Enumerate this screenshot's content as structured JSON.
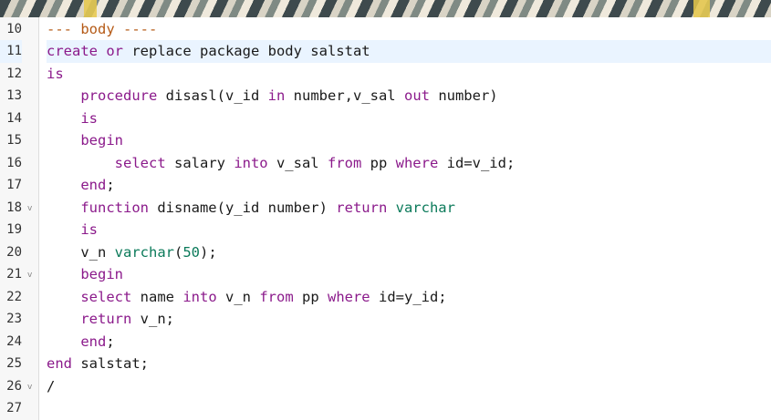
{
  "banner": {
    "colors": [
      "#3e4a4d",
      "#d9d4c6",
      "#e6c84a"
    ]
  },
  "colors": {
    "keyword": "#8b1a8b",
    "type": "#0b7a5a",
    "comment": "#b55a16",
    "plain": "#1a1a1a",
    "gutter_bg": "#f7f7f7",
    "active_line": "#eaf4ff"
  },
  "editor": {
    "active_line": "11",
    "lines": [
      {
        "num": "10",
        "fold": "",
        "segments": [
          {
            "t": "--- body ----",
            "c": "cm"
          }
        ]
      },
      {
        "num": "11",
        "fold": "",
        "segments": [
          {
            "t": "create ",
            "c": "kw"
          },
          {
            "t": "or ",
            "c": "kw"
          },
          {
            "t": "replace package body salstat",
            "c": ""
          }
        ]
      },
      {
        "num": "12",
        "fold": "",
        "segments": [
          {
            "t": "is",
            "c": "kw"
          }
        ]
      },
      {
        "num": "13",
        "fold": "",
        "segments": [
          {
            "t": "    procedure",
            "c": "kw"
          },
          {
            "t": " disasl(v_id ",
            "c": ""
          },
          {
            "t": "in",
            "c": "kw"
          },
          {
            "t": " number,v_sal ",
            "c": ""
          },
          {
            "t": "out",
            "c": "kw"
          },
          {
            "t": " number)",
            "c": ""
          }
        ]
      },
      {
        "num": "14",
        "fold": "",
        "segments": [
          {
            "t": "    is",
            "c": "kw"
          }
        ]
      },
      {
        "num": "15",
        "fold": "",
        "segments": [
          {
            "t": "    begin",
            "c": "kw"
          }
        ]
      },
      {
        "num": "16",
        "fold": "",
        "segments": [
          {
            "t": "        select",
            "c": "kw"
          },
          {
            "t": " salary ",
            "c": ""
          },
          {
            "t": "into",
            "c": "kw"
          },
          {
            "t": " v_sal ",
            "c": ""
          },
          {
            "t": "from",
            "c": "kw"
          },
          {
            "t": " pp ",
            "c": ""
          },
          {
            "t": "where",
            "c": "kw"
          },
          {
            "t": " id=v_id;",
            "c": ""
          }
        ]
      },
      {
        "num": "17",
        "fold": "",
        "segments": [
          {
            "t": "    end",
            "c": "kw"
          },
          {
            "t": ";",
            "c": ""
          }
        ]
      },
      {
        "num": "18",
        "fold": "v",
        "segments": [
          {
            "t": "    function",
            "c": "kw"
          },
          {
            "t": " disname(y_id number) ",
            "c": ""
          },
          {
            "t": "return",
            "c": "kw"
          },
          {
            "t": " ",
            "c": ""
          },
          {
            "t": "varchar",
            "c": "ty"
          }
        ]
      },
      {
        "num": "19",
        "fold": "",
        "segments": [
          {
            "t": "    is",
            "c": "kw"
          }
        ]
      },
      {
        "num": "20",
        "fold": "",
        "segments": [
          {
            "t": "    v_n ",
            "c": ""
          },
          {
            "t": "varchar",
            "c": "ty"
          },
          {
            "t": "(",
            "c": ""
          },
          {
            "t": "50",
            "c": "nm"
          },
          {
            "t": ");",
            "c": ""
          }
        ]
      },
      {
        "num": "21",
        "fold": "v",
        "segments": [
          {
            "t": "    begin",
            "c": "kw"
          }
        ]
      },
      {
        "num": "22",
        "fold": "",
        "segments": [
          {
            "t": "    select",
            "c": "kw"
          },
          {
            "t": " name ",
            "c": ""
          },
          {
            "t": "into",
            "c": "kw"
          },
          {
            "t": " v_n ",
            "c": ""
          },
          {
            "t": "from",
            "c": "kw"
          },
          {
            "t": " pp ",
            "c": ""
          },
          {
            "t": "where",
            "c": "kw"
          },
          {
            "t": " id=y_id;",
            "c": ""
          }
        ]
      },
      {
        "num": "23",
        "fold": "",
        "segments": [
          {
            "t": "    return",
            "c": "kw"
          },
          {
            "t": " v_n;",
            "c": ""
          }
        ]
      },
      {
        "num": "24",
        "fold": "",
        "segments": [
          {
            "t": "    end",
            "c": "kw"
          },
          {
            "t": ";",
            "c": ""
          }
        ]
      },
      {
        "num": "25",
        "fold": "",
        "segments": [
          {
            "t": "end",
            "c": "kw"
          },
          {
            "t": " salstat;",
            "c": ""
          }
        ]
      },
      {
        "num": "26",
        "fold": "v",
        "segments": [
          {
            "t": "/",
            "c": ""
          }
        ]
      },
      {
        "num": "27",
        "fold": "",
        "segments": []
      }
    ]
  }
}
